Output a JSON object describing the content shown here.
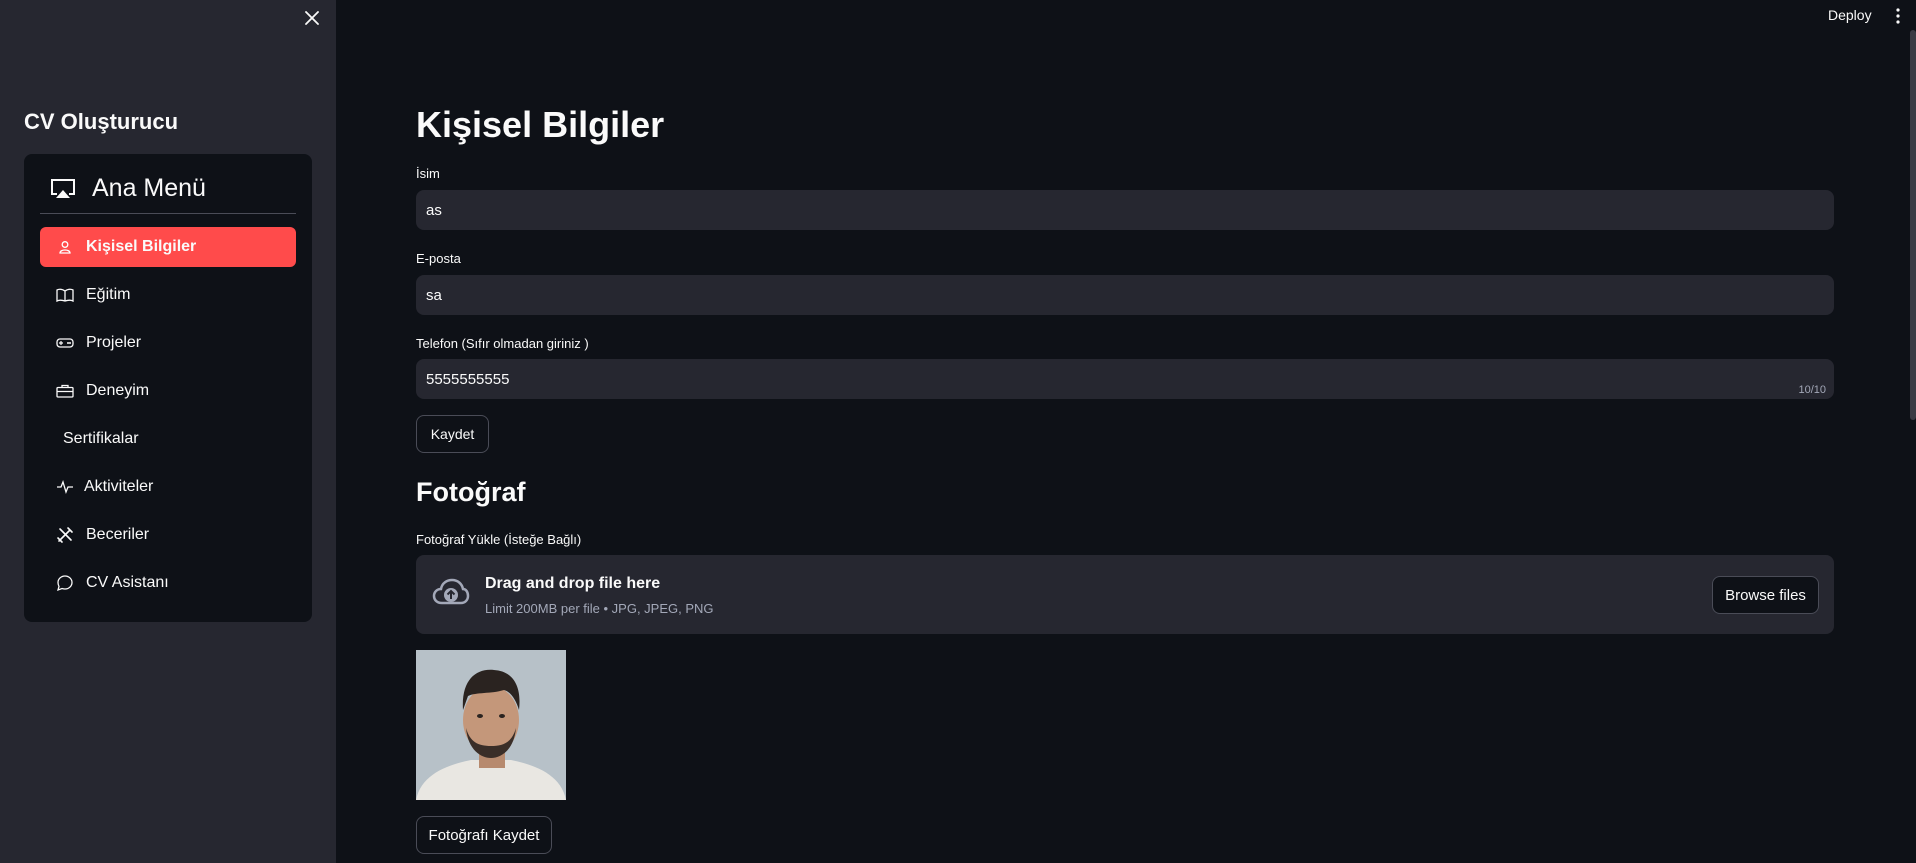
{
  "sidebar": {
    "title": "CV Oluşturucu",
    "menu_header": "Ana Menü",
    "items": [
      {
        "label": "Kişisel Bilgiler",
        "icon": "person-icon",
        "active": true
      },
      {
        "label": "Eğitim",
        "icon": "book-icon"
      },
      {
        "label": "Projeler",
        "icon": "controller-icon"
      },
      {
        "label": "Deneyim",
        "icon": "briefcase-icon"
      },
      {
        "label": "Sertifikalar",
        "icon": ""
      },
      {
        "label": "Aktiviteler",
        "icon": "activity-icon"
      },
      {
        "label": "Beceriler",
        "icon": "tools-icon"
      },
      {
        "label": "CV Asistanı",
        "icon": "chat-icon"
      }
    ]
  },
  "topbar": {
    "deploy_label": "Deploy"
  },
  "main": {
    "title": "Kişisel Bilgiler",
    "name_label": "İsim",
    "name_value": "as",
    "email_label": "E-posta",
    "email_value": "sa",
    "phone_label": "Telefon (Sıfır olmadan giriniz )",
    "phone_value": "5555555555",
    "phone_counter": "10/10",
    "save_label": "Kaydet",
    "photo_title": "Fotoğraf",
    "upload_label": "Fotoğraf Yükle (İsteğe Bağlı)",
    "upload_main": "Drag and drop file here",
    "upload_sub": "Limit 200MB per file • JPG, JPEG, PNG",
    "browse_label": "Browse files",
    "save_photo_label": "Fotoğrafı Kaydet"
  },
  "colors": {
    "accent": "#ff4b4b",
    "background": "#0e1117",
    "sidebar": "#262730"
  }
}
